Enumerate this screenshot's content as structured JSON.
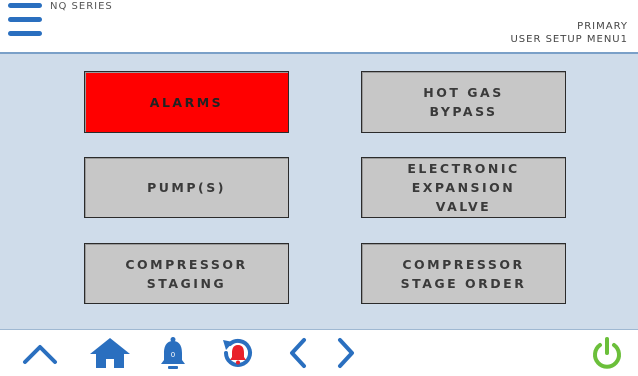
{
  "header": {
    "series": "NQ SERIES",
    "line1": "PRIMARY",
    "line2": "USER SETUP MENU1"
  },
  "buttons": {
    "alarms": "ALARMS",
    "hot_gas_bypass": "HOT GAS\nBYPASS",
    "pumps": "PUMP(S)",
    "eev": "ELECTRONIC\nEXPANSION\nVALVE",
    "compressor_staging": "COMPRESSOR\nSTAGING",
    "compressor_stage_order": "COMPRESSOR\nSTAGE ORDER"
  },
  "footer": {
    "icons": [
      "chevron-up-icon",
      "home-icon",
      "alarm-bell-icon",
      "alarm-reset-icon",
      "chevron-left-icon",
      "chevron-right-icon",
      "power-icon"
    ]
  },
  "colors": {
    "accent_blue": "#2a6fbf",
    "panel_bg": "#cfdcea",
    "tile_gray": "#c7c7c7",
    "alarm_red": "#ff0000",
    "bell_red": "#e8202a",
    "power_green": "#6bbf3a"
  }
}
